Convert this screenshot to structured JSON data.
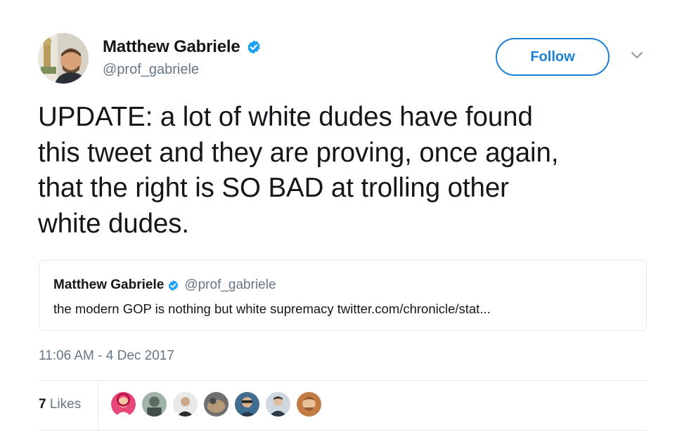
{
  "author": {
    "name": "Matthew Gabriele",
    "handle": "@prof_gabriele",
    "verified": true
  },
  "follow_label": "Follow",
  "menu_icon": "chevron-down-icon",
  "tweet": {
    "lines": [
      "UPDATE: a lot of white dudes have found",
      "this tweet and they are proving, once again,",
      "that the right is SO BAD at trolling other",
      "white dudes."
    ]
  },
  "quoted_tweet": {
    "name": "Matthew Gabriele",
    "handle": "@prof_gabriele",
    "verified": true,
    "text": "the modern GOP is nothing but white supremacy twitter.com/chronicle/stat..."
  },
  "timestamp": "11:06 AM - 4 Dec 2017",
  "likes": {
    "count": "7",
    "label": "Likes"
  },
  "colors": {
    "accent": "#1b7fd6",
    "verified": "#1da1f2",
    "text_primary": "#14171a",
    "text_secondary": "#657786",
    "border": "#e1e8ed"
  },
  "likers": [
    {
      "icon": "avatar-liker-1",
      "bg": "#e8477a",
      "fg": "#f4c9a8"
    },
    {
      "icon": "avatar-liker-2",
      "bg": "#9fb3a8",
      "fg": "#5d6b63"
    },
    {
      "icon": "avatar-liker-3",
      "bg": "#e9e9e9",
      "fg": "#2b2b2b"
    },
    {
      "icon": "avatar-liker-4",
      "bg": "#6f6f6f",
      "fg": "#b79a78"
    },
    {
      "icon": "avatar-liker-5",
      "bg": "#3f6c8f",
      "fg": "#d8b28f"
    },
    {
      "icon": "avatar-liker-6",
      "bg": "#cfd8e0",
      "fg": "#2d3a48"
    },
    {
      "icon": "avatar-liker-7",
      "bg": "#c27b45",
      "fg": "#e8c09a"
    }
  ]
}
